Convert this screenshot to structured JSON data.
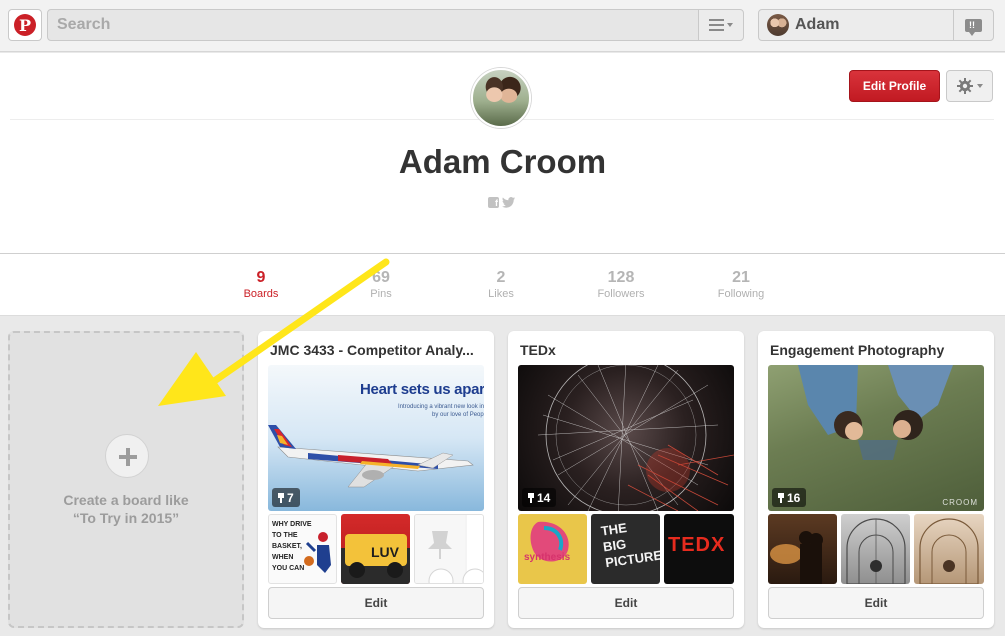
{
  "topbar": {
    "search_placeholder": "Search",
    "user_name": "Adam"
  },
  "profile": {
    "name": "Adam Croom",
    "edit_profile_label": "Edit Profile"
  },
  "stats": [
    {
      "count": "9",
      "label": "Boards",
      "active": true
    },
    {
      "count": "69",
      "label": "Pins",
      "active": false
    },
    {
      "count": "2",
      "label": "Likes",
      "active": false
    },
    {
      "count": "128",
      "label": "Followers",
      "active": false
    },
    {
      "count": "21",
      "label": "Following",
      "active": false
    }
  ],
  "create_board": {
    "line1": "Create a board like",
    "line2": "“To Try in 2015”"
  },
  "boards": [
    {
      "title": "JMC 3433 - Competitor Analy...",
      "pin_count": "7",
      "edit_label": "Edit",
      "cover_headline": "Heart sets us apart",
      "cover_subtext_1": "Introducing a vibrant new look inspired",
      "cover_subtext_2": "by our love of People",
      "thumb1_text": [
        "WHY DRIVE",
        "TO THE",
        "BASKET,",
        "WHEN",
        "YOU CAN"
      ],
      "thumb2_text": "LUV"
    },
    {
      "title": "TEDx",
      "pin_count": "14",
      "edit_label": "Edit",
      "thumb1_text": "synthesis",
      "thumb2_text": [
        "THE",
        "BIG",
        "PICTURE"
      ],
      "thumb3_text": "TEDX"
    },
    {
      "title": "Engagement Photography",
      "pin_count": "16",
      "edit_label": "Edit",
      "cover_watermark": "CROOM"
    }
  ],
  "colors": {
    "brand_red": "#cb2027",
    "arrow_yellow": "#ffe61a"
  }
}
